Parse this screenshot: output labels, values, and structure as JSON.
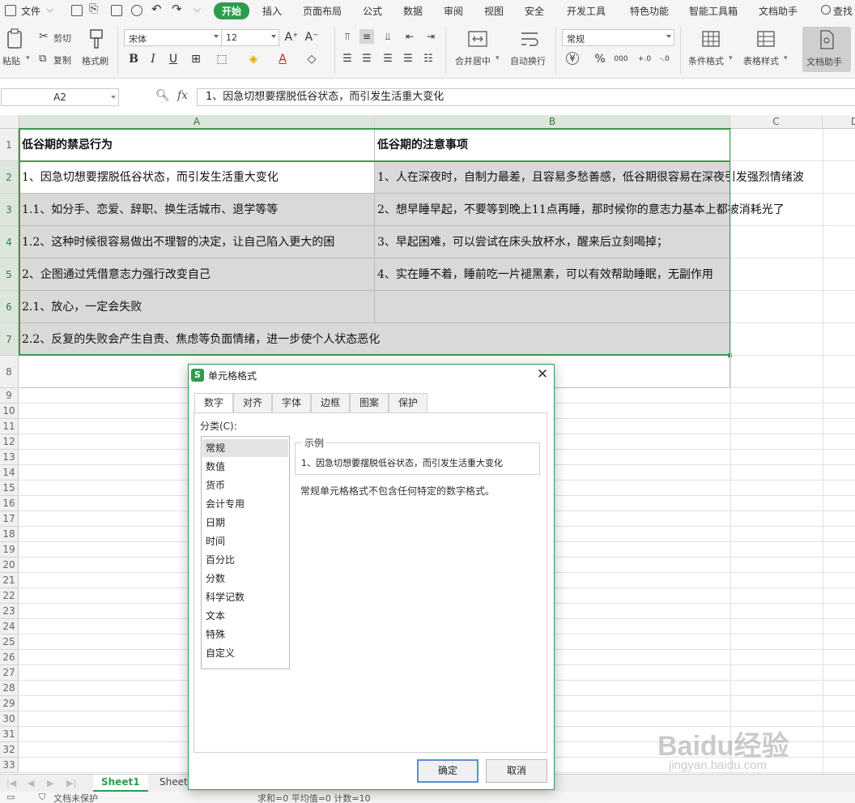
{
  "menu": {
    "file_label": "文件",
    "tabs": [
      "开始",
      "插入",
      "页面布局",
      "公式",
      "数据",
      "审阅",
      "视图",
      "安全",
      "开发工具",
      "特色功能",
      "智能工具箱",
      "文档助手"
    ],
    "active_tab": "开始",
    "search_label": "查找"
  },
  "ribbon": {
    "paste": "粘贴",
    "cut": "剪切",
    "copy": "复制",
    "format_painter": "格式刷",
    "font_name": "宋体",
    "font_size": "12",
    "merge_center": "合并居中",
    "wrap_text": "自动换行",
    "number_format": "常规",
    "currency_symbol": "¥",
    "percent_symbol": "%",
    "thousands_symbol": "000",
    "increase_decimal": "+.0",
    "decrease_decimal": "-.0",
    "conditional_format": "条件格式",
    "table_style": "表格样式",
    "doc_helper": "文档助手"
  },
  "formula_bar": {
    "cell_ref": "A2",
    "fx": "fx",
    "content": "1、因急切想要摆脱低谷状态，而引发生活重大变化"
  },
  "grid": {
    "columns": [
      "A",
      "B",
      "C",
      "D"
    ],
    "rows": [
      "1",
      "2",
      "3",
      "4",
      "5",
      "6",
      "7",
      "8",
      "9",
      "10",
      "11",
      "12",
      "13",
      "14",
      "15",
      "16",
      "17",
      "18",
      "19",
      "20",
      "21",
      "22",
      "23",
      "24",
      "25",
      "26",
      "27",
      "28",
      "29",
      "30",
      "31",
      "32",
      "33"
    ],
    "cells": {
      "A1": "低谷期的禁忌行为",
      "B1": "低谷期的注意事项",
      "A2": "1、因急切想要摆脱低谷状态，而引发生活重大变化",
      "B2": "1、人在深夜时，自制力最差，且容易多愁善感，低谷期很容易在深夜引发强烈情绪波",
      "A3": "1.1、如分手、恋爱、辞职、换生活城市、退学等等",
      "B3": "2、想早睡早起，不要等到晚上11点再睡，那时候你的意志力基本上都被消耗光了",
      "A4": "1.2、这种时候很容易做出不理智的决定，让自己陷入更大的困",
      "B4": "3、早起困难，可以尝试在床头放杯水，醒来后立刻喝掉；",
      "A5": "2、企图通过凭借意志力强行改变自己",
      "B5": "4、实在睡不着，睡前吃一片褪黑素，可以有效帮助睡眠，无副作用",
      "A6": "2.1、放心，一定会失败",
      "B6": "",
      "A7": "2.2、反复的失败会产生自责、焦虑等负面情绪，进一步使个人状态恶化"
    }
  },
  "sheets": [
    "Sheet1",
    "Sheet"
  ],
  "active_sheet": "Sheet1",
  "status": {
    "protect": "文档未保护",
    "summary": "求和=0  平均值=0  计数=10"
  },
  "dialog": {
    "title": "单元格格式",
    "tabs": [
      "数字",
      "对齐",
      "字体",
      "边框",
      "图案",
      "保护"
    ],
    "active_tab": "数字",
    "category_label": "分类(C):",
    "categories": [
      "常规",
      "数值",
      "货币",
      "会计专用",
      "日期",
      "时间",
      "百分比",
      "分数",
      "科学记数",
      "文本",
      "特殊",
      "自定义"
    ],
    "selected_category": "常规",
    "sample_label": "示例",
    "sample_value": "1、因急切想要摆脱低谷状态，而引发生活重大变化",
    "description": "常规单元格格式不包含任何特定的数字格式。",
    "ok": "确定",
    "cancel": "取消"
  },
  "watermark": {
    "brand": "Baidu经验",
    "url": "jingyan.baidu.com"
  },
  "colors": {
    "accent": "#2e9b4e",
    "selection_fill": "#d9d9d9",
    "header_bg": "#f0f0f0"
  }
}
